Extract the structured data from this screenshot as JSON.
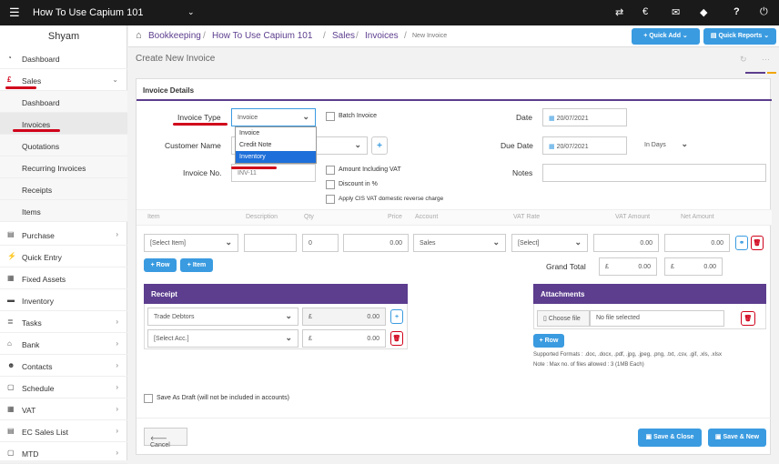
{
  "topbar": {
    "menu_icon": "hamburger-icon",
    "company": "How To Use Capium 101",
    "chevron": "chevron-down-icon",
    "icons": [
      "transfer-icon",
      "currency-icon",
      "megaphone-icon",
      "tag-icon",
      "help-icon",
      "power-icon"
    ],
    "help": "?"
  },
  "sidebar": {
    "user": "Shyam",
    "items": [
      {
        "label": "Dashboard",
        "icon": "gauge-icon"
      },
      {
        "label": "Sales",
        "icon": "pound-icon",
        "expanded": true
      },
      {
        "label": "Dashboard",
        "sub": true
      },
      {
        "label": "Invoices",
        "sub": true,
        "active": true
      },
      {
        "label": "Quotations",
        "sub": true
      },
      {
        "label": "Recurring Invoices",
        "sub": true
      },
      {
        "label": "Receipts",
        "sub": true
      },
      {
        "label": "Items",
        "sub": true
      },
      {
        "label": "Purchase",
        "icon": "list-icon"
      },
      {
        "label": "Quick Entry",
        "icon": "bolt-icon"
      },
      {
        "label": "Fixed Assets",
        "icon": "building-icon"
      },
      {
        "label": "Inventory",
        "icon": "truck-icon"
      },
      {
        "label": "Tasks",
        "icon": "tasks-icon"
      },
      {
        "label": "Bank",
        "icon": "bank-icon"
      },
      {
        "label": "Contacts",
        "icon": "users-icon"
      },
      {
        "label": "Schedule",
        "icon": "calendar-icon"
      },
      {
        "label": "VAT",
        "icon": "vat-icon"
      },
      {
        "label": "EC Sales List",
        "icon": "list-icon"
      },
      {
        "label": "MTD",
        "icon": "calendar-icon"
      }
    ]
  },
  "breadcrumb": {
    "home_icon": "home-icon",
    "items": [
      "Bookkeeping",
      "How To Use Capium 101",
      "Sales",
      "Invoices"
    ],
    "current": "New Invoice",
    "sep": "/"
  },
  "header": {
    "quick_add": "Quick Add",
    "quick_reports": "Quick Reports",
    "title": "Create New Invoice"
  },
  "details": {
    "title": "Invoice Details",
    "invoice_type_label": "Invoice Type",
    "invoice_type_value": "Invoice",
    "batch_invoice": "Batch Invoice",
    "date_label": "Date",
    "date_value": "20/07/2021",
    "customer_label": "Customer Name",
    "due_date_label": "Due Date",
    "due_date_value": "20/07/2021",
    "due_terms": "In Days",
    "invoice_no_label": "Invoice No.",
    "invoice_no_value": "INV-11",
    "amount_incl_vat": "Amount Including VAT",
    "discount": "Discount in %",
    "cis_vat": "Apply CIS VAT domestic reverse charge",
    "notes_label": "Notes"
  },
  "dropdown": {
    "options": [
      "Invoice",
      "Credit Note",
      "Inventory"
    ],
    "selected_index": 2
  },
  "lines": {
    "headers": [
      "Item",
      "Description",
      "Qty",
      "Price",
      "Account",
      "VAT Rate",
      "VAT Amount",
      "Net Amount"
    ],
    "row": {
      "item": "[Select Item]",
      "qty": "0",
      "price": "0.00",
      "account": "Sales",
      "vat_rate": "[Select]",
      "vat_amount": "0.00",
      "net_amount": "0.00"
    },
    "add_row": "Row",
    "add_item": "Item",
    "grand_total_label": "Grand Total",
    "currency": "£",
    "grand_vat": "0.00",
    "grand_net": "0.00"
  },
  "receipt": {
    "title": "Receipt",
    "rows": [
      {
        "account": "Trade Debtors",
        "amount": "0.00"
      },
      {
        "account": "[Select Acc.]",
        "amount": "0.00"
      }
    ],
    "currency": "£"
  },
  "attachments": {
    "title": "Attachments",
    "choose": "Choose file",
    "no_file": "No file selected",
    "add_row": "Row",
    "formats": "Supported Formats : .doc, .docx, .pdf, .jpg, .jpeg, .png, .txt, .csv, .gif, .xls, .xlsx",
    "note": "Note : Max no. of files allowed : 3 (1MB Each)"
  },
  "footer": {
    "draft": "Save As Draft (will not be included in accounts)",
    "cancel": "Cancel",
    "save_close": "Save & Close",
    "save_new": "Save & New"
  },
  "colors": {
    "topbar": "#1a1a1a",
    "accent": "#3a9be0",
    "purple": "#5c3d8e",
    "highlight": "#d0021b"
  }
}
